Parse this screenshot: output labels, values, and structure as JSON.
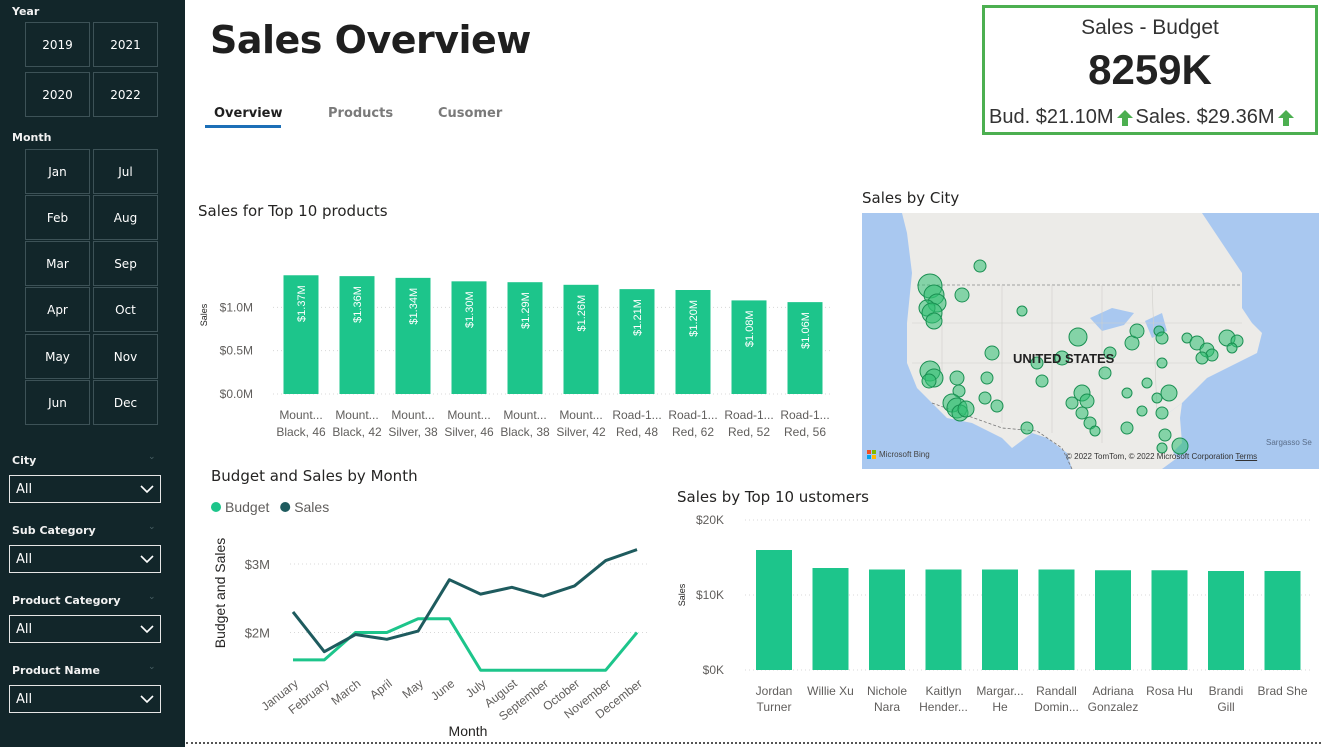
{
  "sidebar": {
    "year_heading": "Year",
    "years": [
      "2019",
      "2021",
      "2020",
      "2022"
    ],
    "month_heading": "Month",
    "months": [
      "Jan",
      "Jul",
      "Feb",
      "Aug",
      "Mar",
      "Sep",
      "Apr",
      "Oct",
      "May",
      "Nov",
      "Jun",
      "Dec"
    ],
    "filters": [
      {
        "label": "City",
        "value": "All"
      },
      {
        "label": "Sub Category",
        "value": "All"
      },
      {
        "label": "Product Category",
        "value": "All"
      },
      {
        "label": "Product Name",
        "value": "All"
      }
    ]
  },
  "header": {
    "title": "Sales Overview",
    "tabs": [
      "Overview",
      "Products",
      "Cusomer"
    ]
  },
  "kpi": {
    "title": "Sales - Budget",
    "value": "8259K",
    "budget": "Bud. $21.10M",
    "sales": "Sales. $29.36M",
    "accent": "#4caf50"
  },
  "map": {
    "title": "Sales by City",
    "country_label": "UNITED STATES",
    "copyright": "© 2022 TomTom, © 2022 Microsoft Corporation",
    "terms": "Terms",
    "bing": "Microsoft Bing",
    "sea": "Sargasso Se",
    "point_color": "#2fbf71"
  },
  "chart_data": [
    {
      "type": "bar",
      "title": "Sales for Top 10 products",
      "ylabel": "Sales",
      "categories": [
        [
          "Mount...",
          "Black, 46"
        ],
        [
          "Mount...",
          "Black, 42"
        ],
        [
          "Mount...",
          "Silver, 38"
        ],
        [
          "Mount...",
          "Silver, 46"
        ],
        [
          "Mount...",
          "Black, 38"
        ],
        [
          "Mount...",
          "Silver, 42"
        ],
        [
          "Road-1...",
          "Red, 48"
        ],
        [
          "Road-1...",
          "Red, 62"
        ],
        [
          "Road-1...",
          "Red, 52"
        ],
        [
          "Road-1...",
          "Red, 56"
        ]
      ],
      "values": [
        1.37,
        1.36,
        1.34,
        1.3,
        1.29,
        1.26,
        1.21,
        1.2,
        1.08,
        1.06
      ],
      "data_labels": [
        "$1.37M",
        "$1.36M",
        "$1.34M",
        "$1.30M",
        "$1.29M",
        "$1.26M",
        "$1.21M",
        "$1.20M",
        "$1.08M",
        "$1.06M"
      ],
      "yticks": [
        "$0.0M",
        "$0.5M",
        "$1.0M"
      ],
      "ytick_values": [
        0,
        0.5,
        1.0
      ],
      "ylim": [
        0,
        1.5
      ],
      "color": "#1dc58b"
    },
    {
      "type": "line",
      "title": "Budget and Sales by Month",
      "xlabel": "Month",
      "ylabel": "Budget and Sales",
      "categories": [
        "January",
        "February",
        "March",
        "April",
        "May",
        "June",
        "July",
        "August",
        "September",
        "October",
        "November",
        "December"
      ],
      "series": [
        {
          "name": "Budget",
          "color": "#1dc58b",
          "values": [
            1.6,
            1.6,
            2.0,
            2.0,
            2.2,
            2.2,
            1.45,
            1.45,
            1.45,
            1.45,
            1.45,
            2.0
          ]
        },
        {
          "name": "Sales",
          "color": "#1e5b5e",
          "values": [
            2.3,
            1.72,
            1.97,
            1.9,
            2.02,
            2.77,
            2.56,
            2.66,
            2.53,
            2.68,
            3.05,
            3.21
          ]
        }
      ],
      "yticks": [
        "$2M",
        "$3M"
      ],
      "ytick_values": [
        2,
        3
      ],
      "ylim": [
        1.35,
        3.35
      ],
      "legend": "top-left"
    },
    {
      "type": "bar",
      "title": "Sales by Top 10 ustomers",
      "ylabel": "Sales",
      "categories": [
        [
          "Jordan",
          "Turner"
        ],
        [
          "Willie Xu",
          ""
        ],
        [
          "Nichole",
          "Nara"
        ],
        [
          "Kaitlyn",
          "Hender..."
        ],
        [
          "Margar...",
          "He"
        ],
        [
          "Randall",
          "Domin..."
        ],
        [
          "Adriana",
          "Gonzalez"
        ],
        [
          "Rosa Hu",
          ""
        ],
        [
          "Brandi",
          "Gill"
        ],
        [
          "Brad She",
          ""
        ]
      ],
      "values": [
        16.0,
        13.6,
        13.4,
        13.4,
        13.4,
        13.4,
        13.3,
        13.3,
        13.2,
        13.2
      ],
      "yticks": [
        "$0K",
        "$10K",
        "$20K"
      ],
      "ytick_values": [
        0,
        10,
        20
      ],
      "ylim": [
        0,
        20
      ],
      "color": "#1dc58b"
    }
  ]
}
